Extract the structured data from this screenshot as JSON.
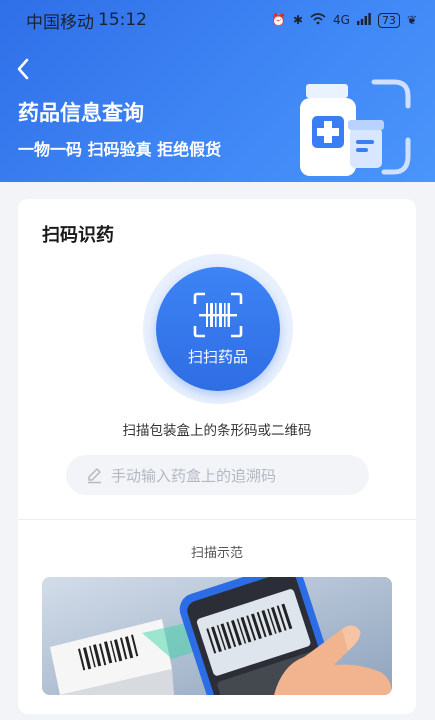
{
  "status_bar": {
    "carrier": "中国移动",
    "time": "15:12",
    "network": "4G",
    "battery": "73"
  },
  "header": {
    "title": "药品信息查询",
    "subtitle": "一物一码 扫码验真 拒绝假货"
  },
  "card": {
    "title": "扫码识药",
    "scan_button_label": "扫扫药品",
    "scan_hint": "扫描包装盒上的条形码或二维码",
    "manual_input_placeholder": "手动输入药盒上的追溯码",
    "demo_title": "扫描示范"
  },
  "colors": {
    "primary": "#2f6fe8",
    "header_gradient_end": "#4a95fb",
    "page_bg": "#f2f4f8",
    "accent_green": "#2fd3a0"
  }
}
